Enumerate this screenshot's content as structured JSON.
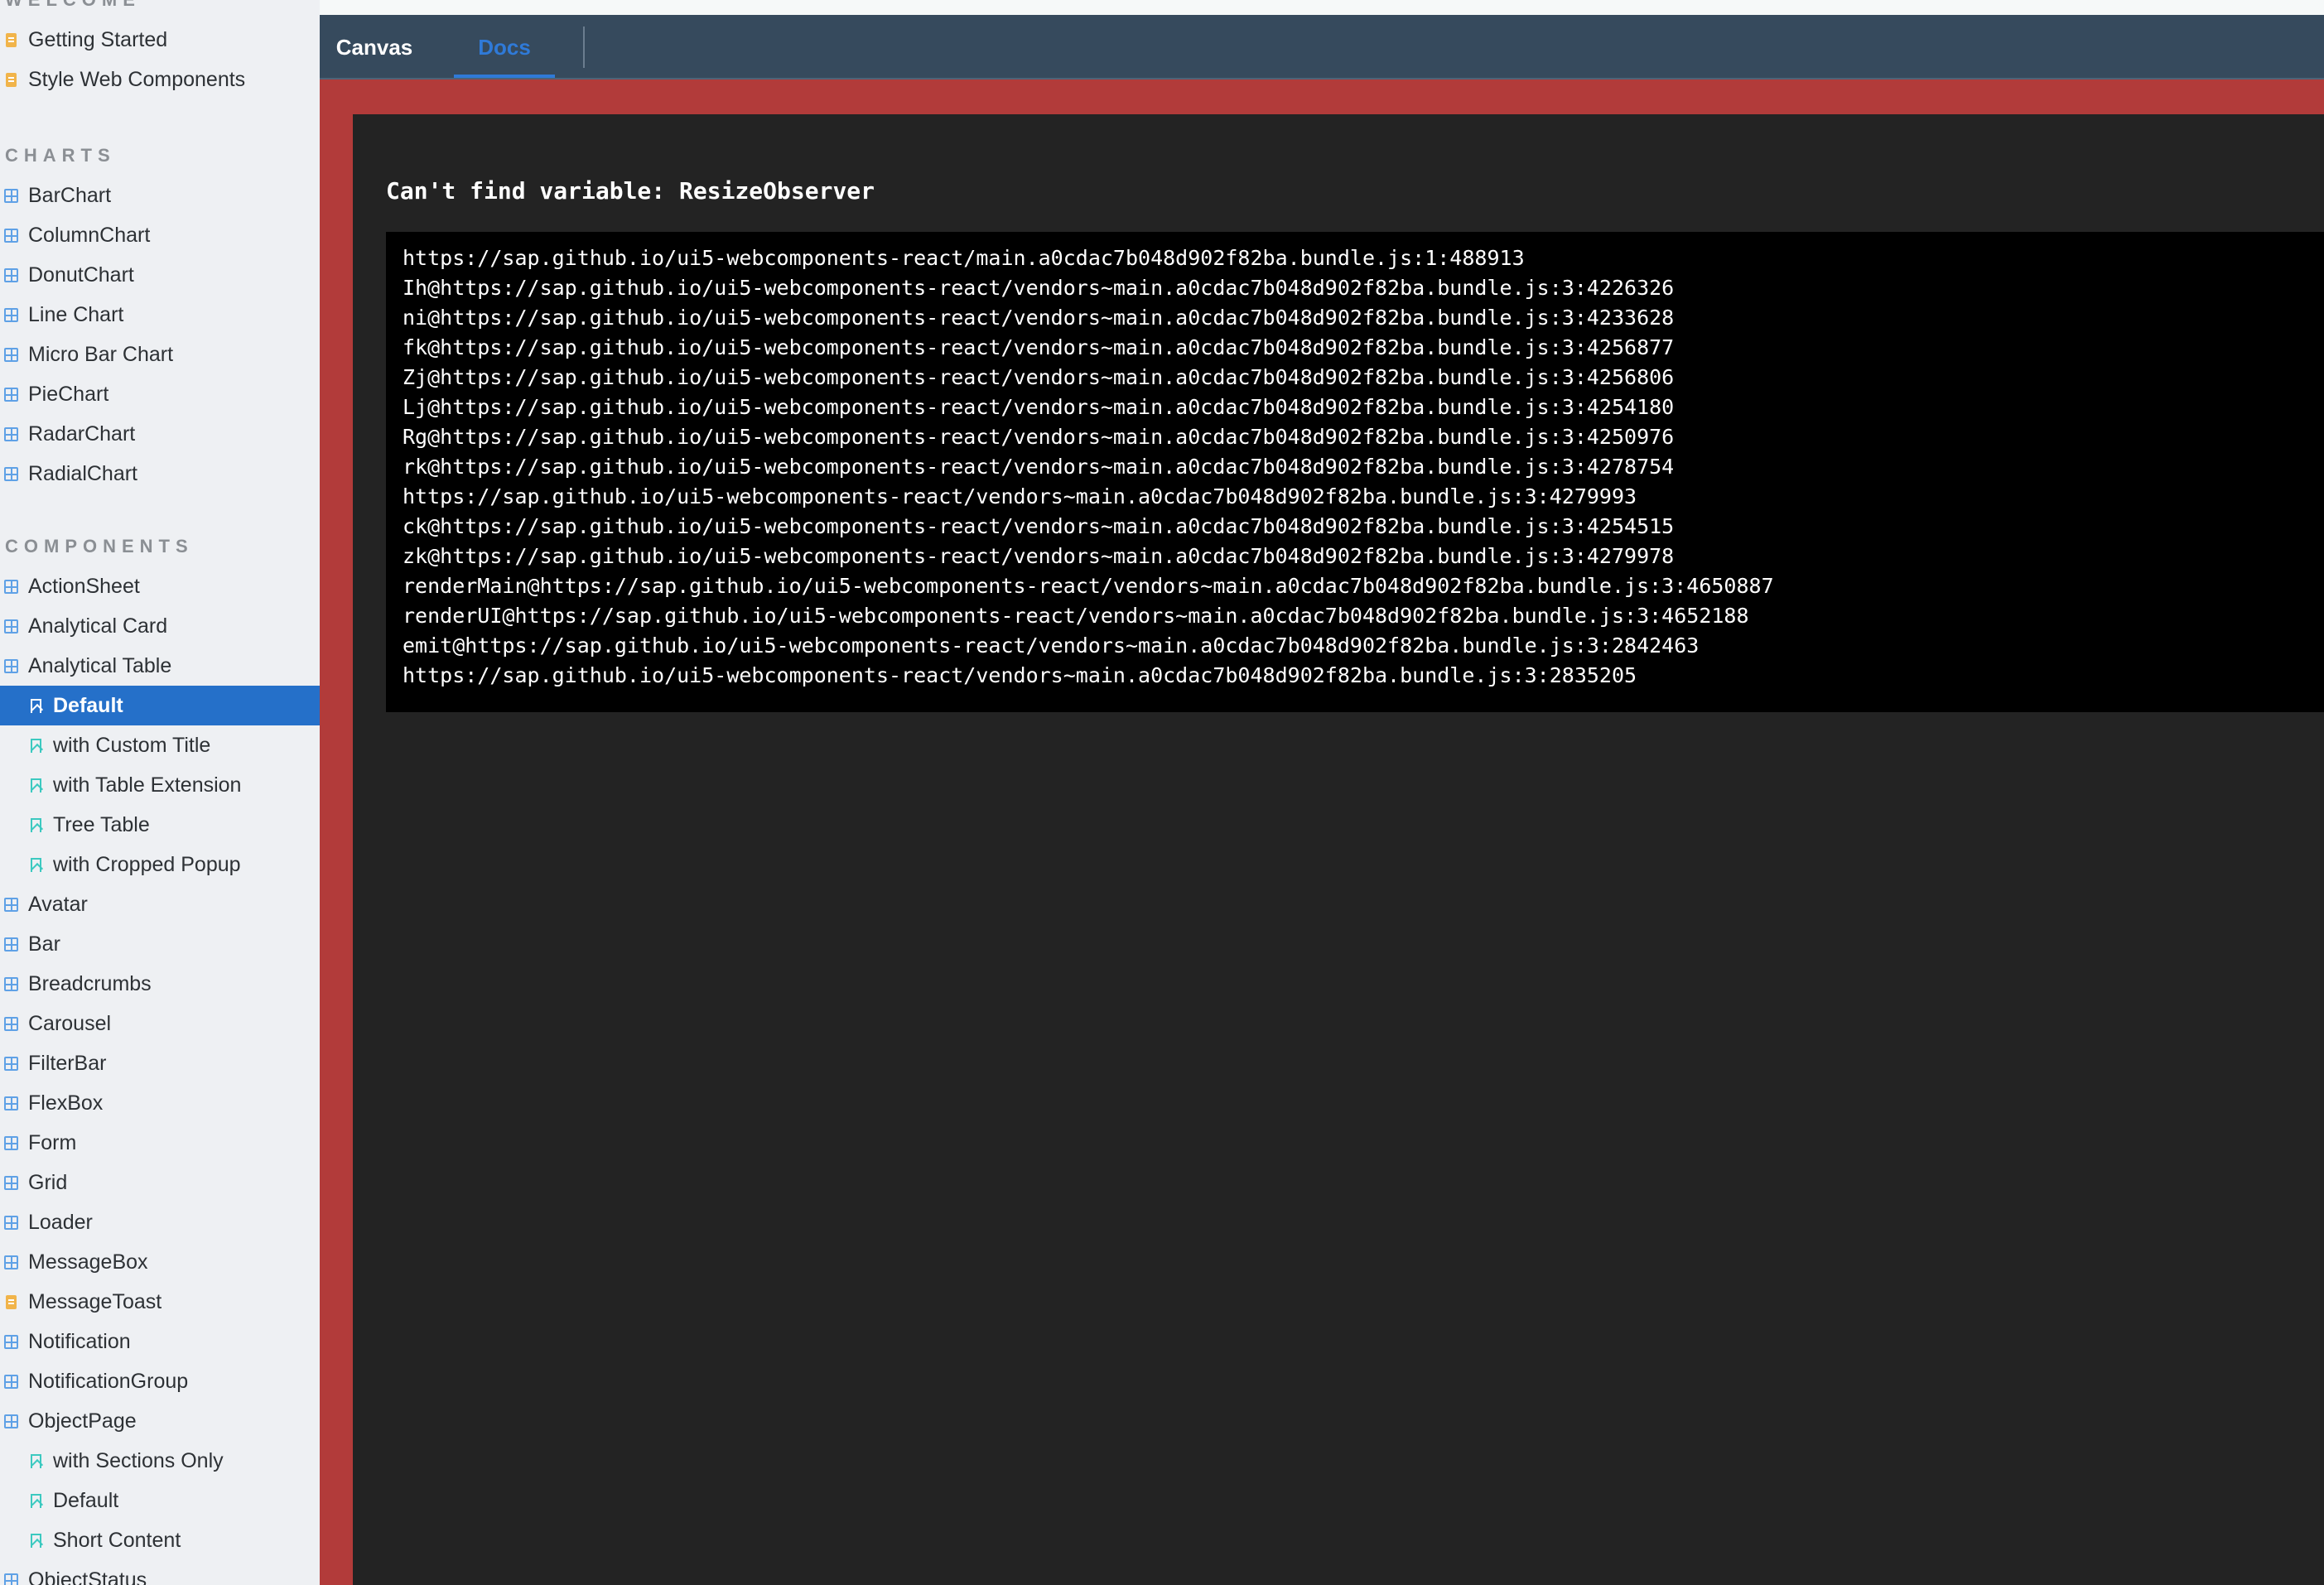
{
  "sidebar": {
    "sections": [
      {
        "title": "WELCOME",
        "items": [
          {
            "label": "Getting Started",
            "icon": "doc-icon",
            "level": 0
          },
          {
            "label": "Style Web Components",
            "icon": "doc-icon",
            "level": 0
          }
        ]
      },
      {
        "title": "CHARTS",
        "items": [
          {
            "label": "BarChart",
            "icon": "component-icon",
            "level": 0
          },
          {
            "label": "ColumnChart",
            "icon": "component-icon",
            "level": 0
          },
          {
            "label": "DonutChart",
            "icon": "component-icon",
            "level": 0
          },
          {
            "label": "Line Chart",
            "icon": "component-icon",
            "level": 0
          },
          {
            "label": "Micro Bar Chart",
            "icon": "component-icon",
            "level": 0
          },
          {
            "label": "PieChart",
            "icon": "component-icon",
            "level": 0
          },
          {
            "label": "RadarChart",
            "icon": "component-icon",
            "level": 0
          },
          {
            "label": "RadialChart",
            "icon": "component-icon",
            "level": 0
          }
        ]
      },
      {
        "title": "COMPONENTS",
        "items": [
          {
            "label": "ActionSheet",
            "icon": "component-icon",
            "level": 0
          },
          {
            "label": "Analytical Card",
            "icon": "component-icon",
            "level": 0
          },
          {
            "label": "Analytical Table",
            "icon": "component-icon",
            "level": 0
          },
          {
            "label": "Default",
            "icon": "story-icon",
            "level": 1,
            "selected": true
          },
          {
            "label": "with Custom Title",
            "icon": "story-icon",
            "level": 1
          },
          {
            "label": "with Table Extension",
            "icon": "story-icon",
            "level": 1
          },
          {
            "label": "Tree Table",
            "icon": "story-icon",
            "level": 1
          },
          {
            "label": "with Cropped Popup",
            "icon": "story-icon",
            "level": 1
          },
          {
            "label": "Avatar",
            "icon": "component-icon",
            "level": 0
          },
          {
            "label": "Bar",
            "icon": "component-icon",
            "level": 0
          },
          {
            "label": "Breadcrumbs",
            "icon": "component-icon",
            "level": 0
          },
          {
            "label": "Carousel",
            "icon": "component-icon",
            "level": 0
          },
          {
            "label": "FilterBar",
            "icon": "component-icon",
            "level": 0
          },
          {
            "label": "FlexBox",
            "icon": "component-icon",
            "level": 0
          },
          {
            "label": "Form",
            "icon": "component-icon",
            "level": 0
          },
          {
            "label": "Grid",
            "icon": "component-icon",
            "level": 0
          },
          {
            "label": "Loader",
            "icon": "component-icon",
            "level": 0
          },
          {
            "label": "MessageBox",
            "icon": "component-icon",
            "level": 0
          },
          {
            "label": "MessageToast",
            "icon": "doc-icon",
            "level": 0
          },
          {
            "label": "Notification",
            "icon": "component-icon",
            "level": 0
          },
          {
            "label": "NotificationGroup",
            "icon": "component-icon",
            "level": 0
          },
          {
            "label": "ObjectPage",
            "icon": "component-icon",
            "level": 0
          },
          {
            "label": "with Sections Only",
            "icon": "story-icon",
            "level": 1
          },
          {
            "label": "Default",
            "icon": "story-icon",
            "level": 1
          },
          {
            "label": "Short Content",
            "icon": "story-icon",
            "level": 1
          },
          {
            "label": "ObjectStatus",
            "icon": "component-icon",
            "level": 0
          }
        ]
      }
    ]
  },
  "tabs": {
    "canvas_label": "Canvas",
    "docs_label": "Docs",
    "active": "Docs"
  },
  "error": {
    "title": "Can't find variable: ResizeObserver",
    "stack": [
      "https://sap.github.io/ui5-webcomponents-react/main.a0cdac7b048d902f82ba.bundle.js:1:488913",
      "Ih@https://sap.github.io/ui5-webcomponents-react/vendors~main.a0cdac7b048d902f82ba.bundle.js:3:4226326",
      "ni@https://sap.github.io/ui5-webcomponents-react/vendors~main.a0cdac7b048d902f82ba.bundle.js:3:4233628",
      "fk@https://sap.github.io/ui5-webcomponents-react/vendors~main.a0cdac7b048d902f82ba.bundle.js:3:4256877",
      "Zj@https://sap.github.io/ui5-webcomponents-react/vendors~main.a0cdac7b048d902f82ba.bundle.js:3:4256806",
      "Lj@https://sap.github.io/ui5-webcomponents-react/vendors~main.a0cdac7b048d902f82ba.bundle.js:3:4254180",
      "Rg@https://sap.github.io/ui5-webcomponents-react/vendors~main.a0cdac7b048d902f82ba.bundle.js:3:4250976",
      "rk@https://sap.github.io/ui5-webcomponents-react/vendors~main.a0cdac7b048d902f82ba.bundle.js:3:4278754",
      "https://sap.github.io/ui5-webcomponents-react/vendors~main.a0cdac7b048d902f82ba.bundle.js:3:4279993",
      "ck@https://sap.github.io/ui5-webcomponents-react/vendors~main.a0cdac7b048d902f82ba.bundle.js:3:4254515",
      "zk@https://sap.github.io/ui5-webcomponents-react/vendors~main.a0cdac7b048d902f82ba.bundle.js:3:4279978",
      "renderMain@https://sap.github.io/ui5-webcomponents-react/vendors~main.a0cdac7b048d902f82ba.bundle.js:3:4650887",
      "renderUI@https://sap.github.io/ui5-webcomponents-react/vendors~main.a0cdac7b048d902f82ba.bundle.js:3:4652188",
      "emit@https://sap.github.io/ui5-webcomponents-react/vendors~main.a0cdac7b048d902f82ba.bundle.js:3:2842463",
      "https://sap.github.io/ui5-webcomponents-react/vendors~main.a0cdac7b048d902f82ba.bundle.js:3:2835205"
    ]
  },
  "colors": {
    "sidebar_bg": "#eef0f3",
    "selected_bg": "#2570c9",
    "tabbar_bg": "#364a5d",
    "active_tab": "#2f7ad8",
    "error_border": "#b23b3a",
    "error_bg": "#232323",
    "stack_bg": "#000000"
  }
}
